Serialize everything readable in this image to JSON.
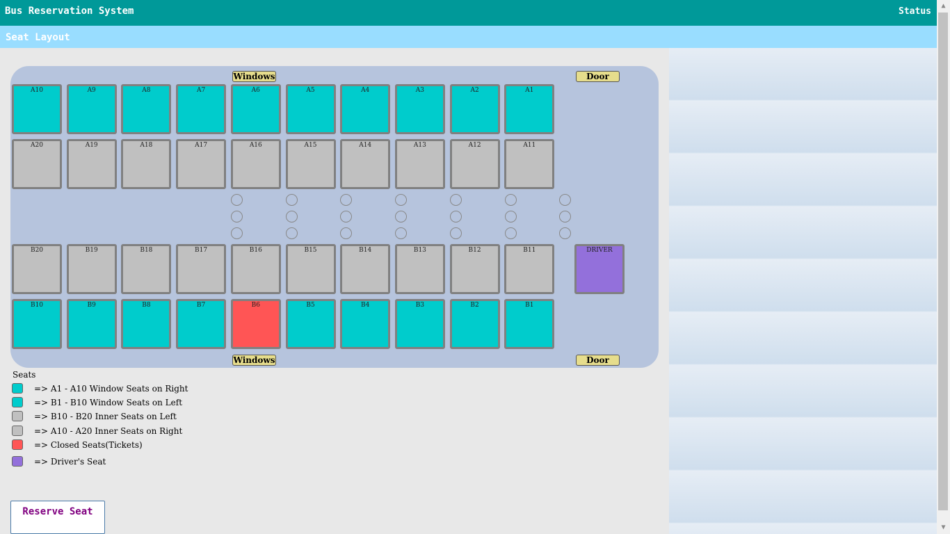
{
  "app": {
    "title": "Bus Reservation System",
    "status_link": "Status"
  },
  "section": {
    "title": "Seat Layout"
  },
  "bus": {
    "windows_label": "Windows",
    "door_label": "Door",
    "driver_label": "DRIVER",
    "rows": [
      [
        "A10",
        "A9",
        "A8",
        "A7",
        "A6",
        "A5",
        "A4",
        "A3",
        "A2",
        "A1"
      ],
      [
        "A20",
        "A19",
        "A18",
        "A17",
        "A16",
        "A15",
        "A14",
        "A13",
        "A12",
        "A11"
      ],
      [
        "B20",
        "B19",
        "B18",
        "B17",
        "B16",
        "B15",
        "B14",
        "B13",
        "B12",
        "B11"
      ],
      [
        "B10",
        "B9",
        "B8",
        "B7",
        "B6",
        "B5",
        "B4",
        "B3",
        "B2",
        "B1"
      ]
    ],
    "row_types": [
      "window",
      "inner",
      "inner",
      "window"
    ],
    "closed_seats": [
      "B6"
    ]
  },
  "legend": {
    "title": "Seats",
    "items": [
      {
        "color": "#00cccc",
        "text": "=> A1 - A10 Window Seats on Right"
      },
      {
        "color": "#00cccc",
        "text": "=> B1 - B10 Window Seats on Left"
      },
      {
        "color": "#c0c0c0",
        "text": "=> B10 - B20 Inner Seats on Left"
      },
      {
        "color": "#c0c0c0",
        "text": "=> A10 - A20 Inner Seats on Right"
      },
      {
        "color": "#ff5555",
        "text": "=> Closed Seats(Tickets)"
      },
      {
        "color": "#9370db",
        "text": "=> Driver's Seat"
      }
    ]
  },
  "actions": {
    "reserve_label": "Reserve Seat"
  },
  "scrollbar": {
    "up_icon": "▲",
    "down_icon": "▼"
  }
}
